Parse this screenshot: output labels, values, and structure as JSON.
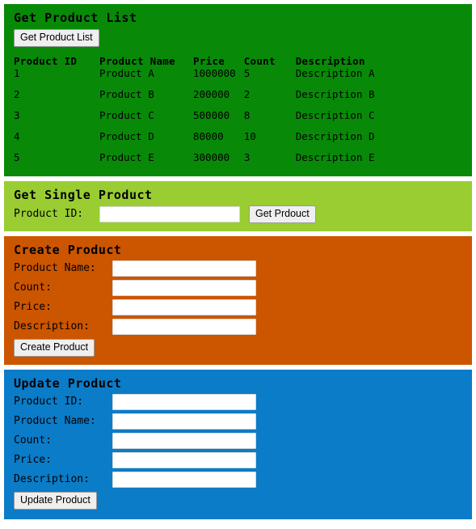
{
  "colors": {
    "list_bg": "#088a08",
    "single_bg": "#9acd32",
    "create_bg": "#cc5500",
    "update_bg": "#0b7cc8",
    "button_bg": "#efefef",
    "text": "#000000"
  },
  "get_product_list": {
    "title": "Get Product List",
    "button_label": "Get Product List",
    "table": {
      "headers": [
        "Product ID",
        "Product Name",
        "Price",
        "Count",
        "Description"
      ],
      "rows": [
        [
          "1",
          "Product A",
          "1000000",
          "5",
          "Description A"
        ],
        [
          "2",
          "Product B",
          "200000",
          "2",
          "Description B"
        ],
        [
          "3",
          "Product C",
          "500000",
          "8",
          "Description C"
        ],
        [
          "4",
          "Product D",
          "80000",
          "10",
          "Description D"
        ],
        [
          "5",
          "Product E",
          "300000",
          "3",
          "Description E"
        ]
      ]
    }
  },
  "get_single_product": {
    "title": "Get Single Product",
    "product_id_label": "Product ID:",
    "product_id_value": "",
    "button_label": "Get Prdouct"
  },
  "create_product": {
    "title": "Create Product",
    "fields": [
      {
        "label": "Product Name:",
        "value": ""
      },
      {
        "label": "Count:",
        "value": ""
      },
      {
        "label": "Price:",
        "value": ""
      },
      {
        "label": "Description:",
        "value": ""
      }
    ],
    "button_label": "Create Product"
  },
  "update_product": {
    "title": "Update Product",
    "fields": [
      {
        "label": "Product ID:",
        "value": ""
      },
      {
        "label": "Product Name:",
        "value": ""
      },
      {
        "label": "Count:",
        "value": ""
      },
      {
        "label": "Price:",
        "value": ""
      },
      {
        "label": "Description:",
        "value": ""
      }
    ],
    "button_label": "Update Product"
  }
}
